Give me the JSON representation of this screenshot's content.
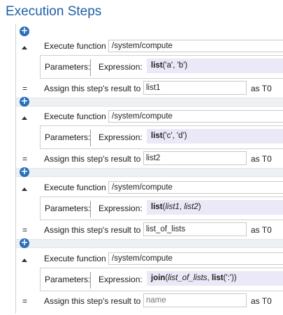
{
  "page": {
    "title": "Execution Steps"
  },
  "labels": {
    "execute_function": "Execute function",
    "parameters": "Parameters:",
    "expression": "Expression:",
    "assign": "Assign this step's result to",
    "equals": "="
  },
  "add_button": {
    "glyph": "+",
    "icon": "plus-icon"
  },
  "steps": [
    {
      "function": "/system/compute",
      "expression": [
        {
          "t": "list",
          "s": "b"
        },
        {
          "t": "('a', 'b')",
          "s": ""
        }
      ],
      "result": "list1",
      "result_placeholder": "",
      "as_label": "as T0"
    },
    {
      "function": "/system/compute",
      "expression": [
        {
          "t": "list",
          "s": "b"
        },
        {
          "t": "('c', 'd')",
          "s": ""
        }
      ],
      "result": "list2",
      "result_placeholder": "",
      "as_label": "as T0"
    },
    {
      "function": "/system/compute",
      "expression": [
        {
          "t": "list",
          "s": "b"
        },
        {
          "t": "(",
          "s": ""
        },
        {
          "t": "list1",
          "s": "i"
        },
        {
          "t": ", ",
          "s": ""
        },
        {
          "t": "list2",
          "s": "i"
        },
        {
          "t": ")",
          "s": ""
        }
      ],
      "result": "list_of_lists",
      "result_placeholder": "",
      "as_label": "as T0"
    },
    {
      "function": "/system/compute",
      "expression": [
        {
          "t": "join",
          "s": "b"
        },
        {
          "t": "(",
          "s": ""
        },
        {
          "t": "list_of_lists",
          "s": "i"
        },
        {
          "t": ", ",
          "s": ""
        },
        {
          "t": "list",
          "s": "b"
        },
        {
          "t": "(':'))",
          "s": ""
        }
      ],
      "result": "",
      "result_placeholder": "name",
      "as_label": "as T0"
    }
  ],
  "colors": {
    "title": "#1f5fa8",
    "add_button": "#2a6fb8",
    "expression_bg": "#ebe8f7"
  }
}
